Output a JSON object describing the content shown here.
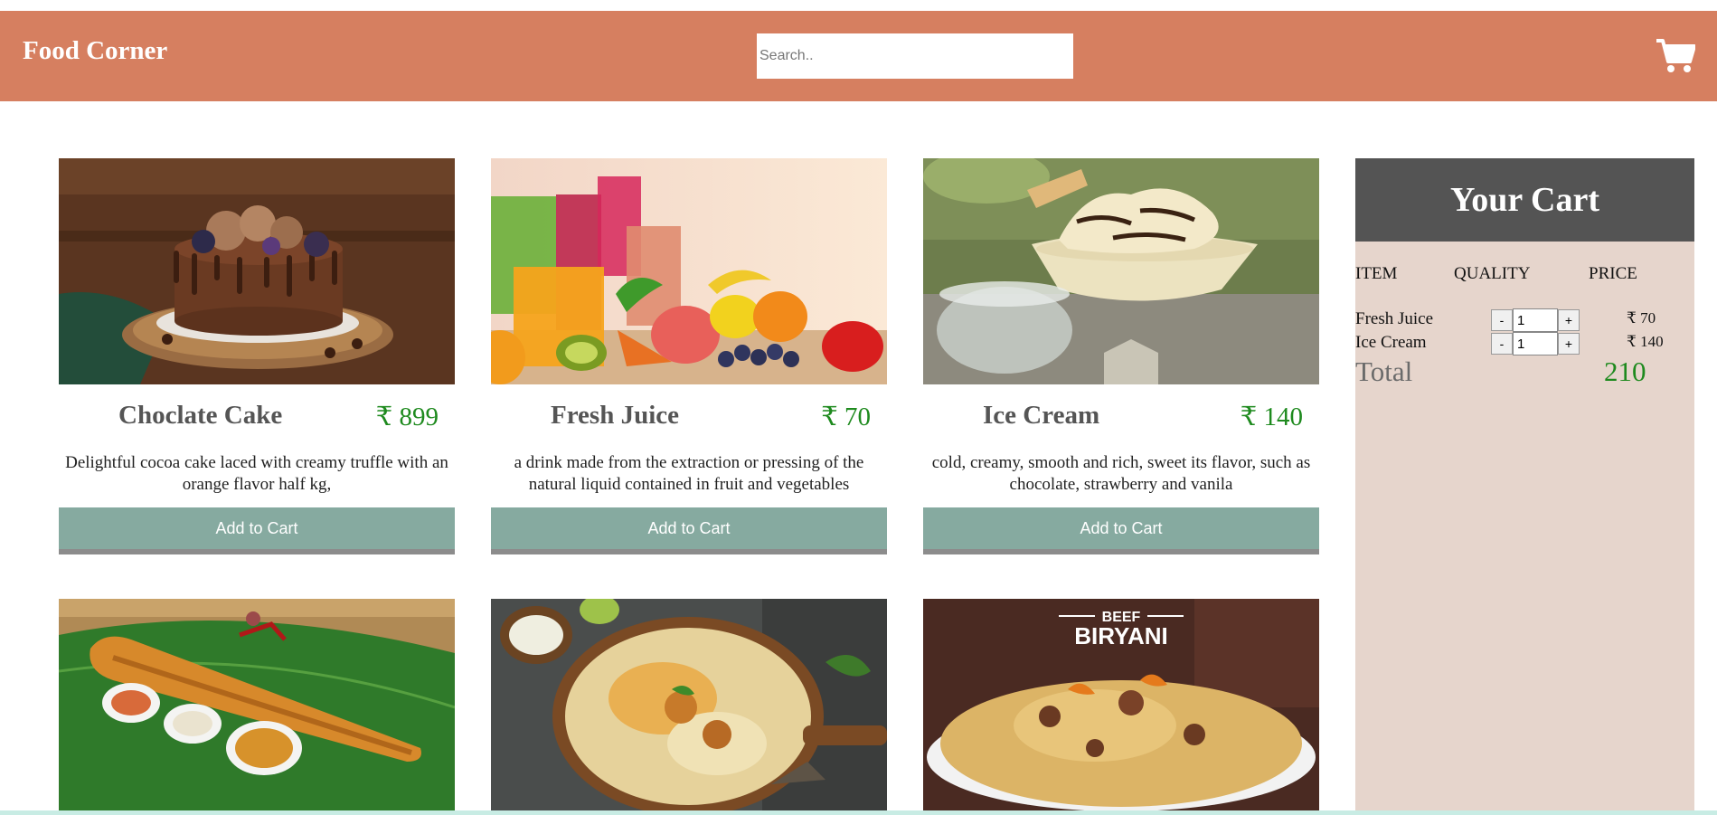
{
  "header": {
    "brand": "Food Corner",
    "search_placeholder": "Search..",
    "cart_icon": "shopping-cart-icon"
  },
  "currency_symbol": "₹",
  "products": [
    {
      "name": "Choclate Cake",
      "price": "₹ 899",
      "description": "Delightful cocoa cake laced with creamy truffle with an orange flavor half kg,",
      "button": "Add to Cart"
    },
    {
      "name": "Fresh Juice",
      "price": "₹ 70",
      "description": "a drink made from the extraction or pressing of the natural liquid contained in fruit and vegetables",
      "button": "Add to Cart"
    },
    {
      "name": "Ice Cream",
      "price": "₹ 140",
      "description": "cold, creamy, smooth and rich, sweet its flavor, such as chocolate, strawberry and vanila",
      "button": "Add to Cart"
    }
  ],
  "more_products": [
    {
      "image": "masala-dosa-photo"
    },
    {
      "image": "chicken-biryani-photo"
    },
    {
      "image": "beef-biryani-photo",
      "image_text_small": "BEEF",
      "image_text_large": "BIRYANI"
    }
  ],
  "cart": {
    "title": "Your Cart",
    "columns": [
      "ITEM",
      "QUALITY",
      "PRICE"
    ],
    "items": [
      {
        "name": "Fresh Juice",
        "qty": "1",
        "price": "₹ 70",
        "minus": "-",
        "plus": "+"
      },
      {
        "name": "Ice Cream",
        "qty": "1",
        "price": "₹ 140",
        "minus": "-",
        "plus": "+"
      }
    ],
    "total_label": "Total",
    "total_value": "210"
  },
  "colors": {
    "header_bg": "#d67f60",
    "button_bg": "#86aaa0",
    "cart_bg": "#e6d5cc",
    "cart_head_bg": "#545454",
    "price_green": "#1e8a1e"
  }
}
